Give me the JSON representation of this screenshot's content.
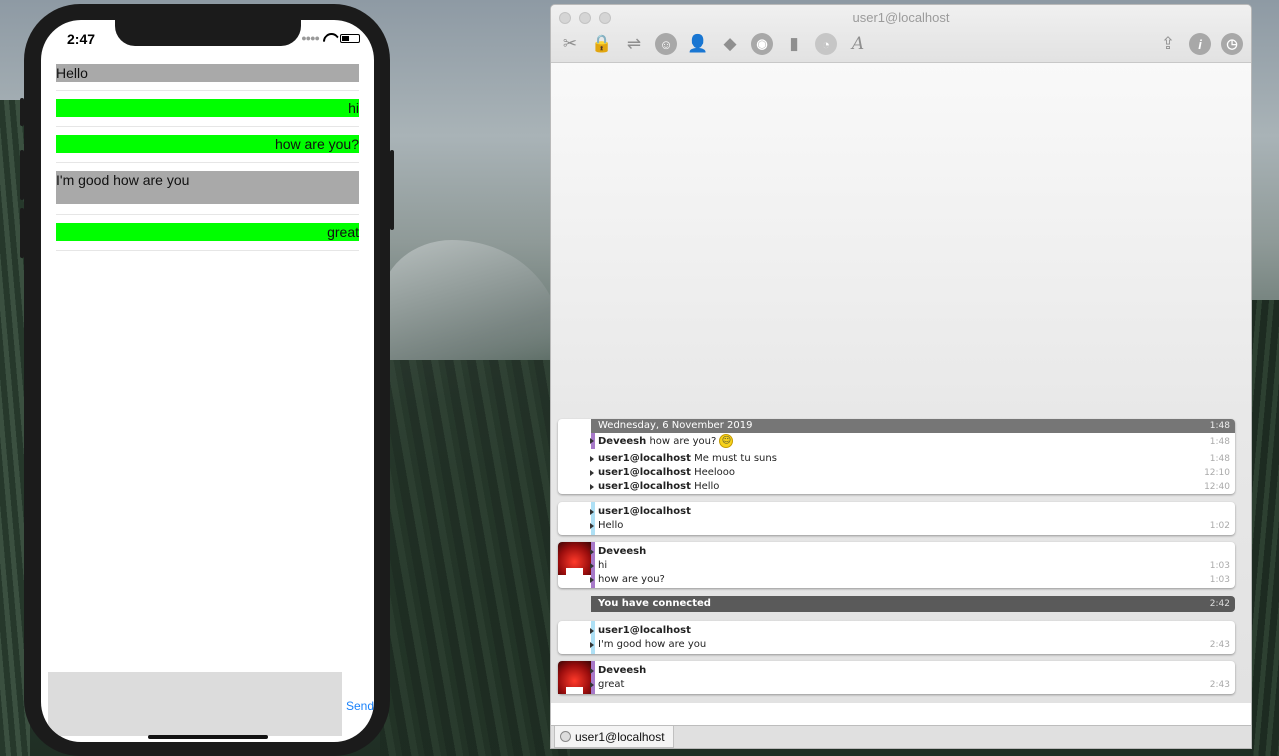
{
  "phone": {
    "status_time": "2:47",
    "messages": [
      {
        "text": "Hello",
        "side": "incoming"
      },
      {
        "text": "hi",
        "side": "outgoing"
      },
      {
        "text": "how are you?",
        "side": "outgoing"
      },
      {
        "text": "I'm good how are you",
        "side": "incoming"
      },
      {
        "text": "great",
        "side": "outgoing"
      }
    ],
    "send_label": "Send",
    "incoming_color": "#a9a9a9",
    "outgoing_color": "#00ff00"
  },
  "adium": {
    "title": "user1@localhost",
    "toolbar_icons": [
      "tools-icon",
      "lock-icon",
      "signpost-icon",
      "smiley-icon",
      "contact-icon",
      "direct-connect-icon",
      "cd-icon",
      "address-book-icon",
      "pie-icon",
      "font-icon",
      "send-file-icon",
      "info-icon",
      "clock-icon"
    ],
    "history": {
      "date": "Wednesday, 6 November 2019",
      "date_time": "1:48",
      "lines": [
        {
          "sender": "Deveesh",
          "text": "how are you?",
          "time": "1:48",
          "emoticon": true
        },
        {
          "sender": "user1@localhost",
          "text": "Me must tu suns",
          "time": "1:48"
        },
        {
          "sender": "user1@localhost",
          "text": "Heelooo",
          "time": "12:10"
        },
        {
          "sender": "user1@localhost",
          "text": "Hello",
          "time": "12:40"
        }
      ]
    },
    "groups": [
      {
        "sender": "user1@localhost",
        "lines": [
          {
            "text": "Hello",
            "time": "1:02"
          }
        ]
      },
      {
        "sender": "Deveesh",
        "lines": [
          {
            "text": "hi",
            "time": "1:03"
          },
          {
            "text": "how are you?",
            "time": "1:03"
          }
        ]
      },
      {
        "status": "You have connected",
        "time": "2:42"
      },
      {
        "sender": "user1@localhost",
        "lines": [
          {
            "text": "I'm good how are you",
            "time": "2:43"
          }
        ]
      },
      {
        "sender": "Deveesh",
        "lines": [
          {
            "text": "great",
            "time": "2:43"
          }
        ]
      }
    ],
    "tab_label": "user1@localhost"
  }
}
